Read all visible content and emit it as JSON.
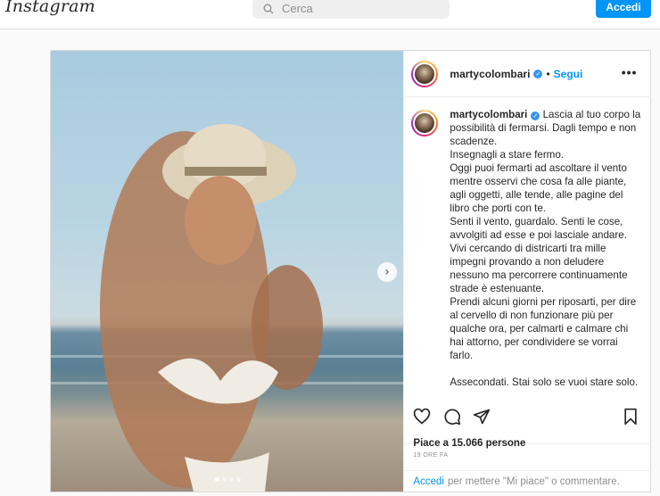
{
  "header": {
    "logo": "Instagram",
    "search_placeholder": "Cerca",
    "login_label": "Accedi"
  },
  "post": {
    "username": "martycolombari",
    "follow_label": "Segui",
    "separator": "•",
    "more_label": "•••",
    "caption_username": "martycolombari",
    "caption": " Lascia al tuo corpo la possibilità di fermarsi. Dagli tempo e non scadenze.\nInsegnagli a stare fermo.\nOggi puoi fermarti ad ascoltare il vento mentre osservi che cosa fa alle piante, agli oggetti, alle tende, alle pagine del libro che porti con te.\nSenti il vento, guardalo. Senti le cose, avvolgiti ad esse e poi lasciale andare.\nVivi cercando di districarti tra mille impegni provando a non deludere nessuno ma percorrere continuamente strade è estenuante.\nPrendi alcuni giorni per riposarti, per dire al cervello di non funzionare più per qualche ora, per calmarti e calmare chi hai attorno, per condividere se vorrai farlo.\n\nAssecondati. Stai solo se vuoi stare solo.",
    "likes_text": "Piace a 15.066 persone",
    "time_text": "19 ORE FA",
    "comment_link": "Accedi",
    "comment_text": "per mettere \"Mi piace\" o commentare.",
    "carousel_total": 4,
    "carousel_active": 1,
    "next_arrow": "›"
  },
  "icons": {
    "search": "search-icon",
    "verified": "verified-badge-icon",
    "like": "heart-icon",
    "comment": "comment-icon",
    "share": "share-icon",
    "save": "bookmark-icon",
    "next": "chevron-right-icon"
  }
}
